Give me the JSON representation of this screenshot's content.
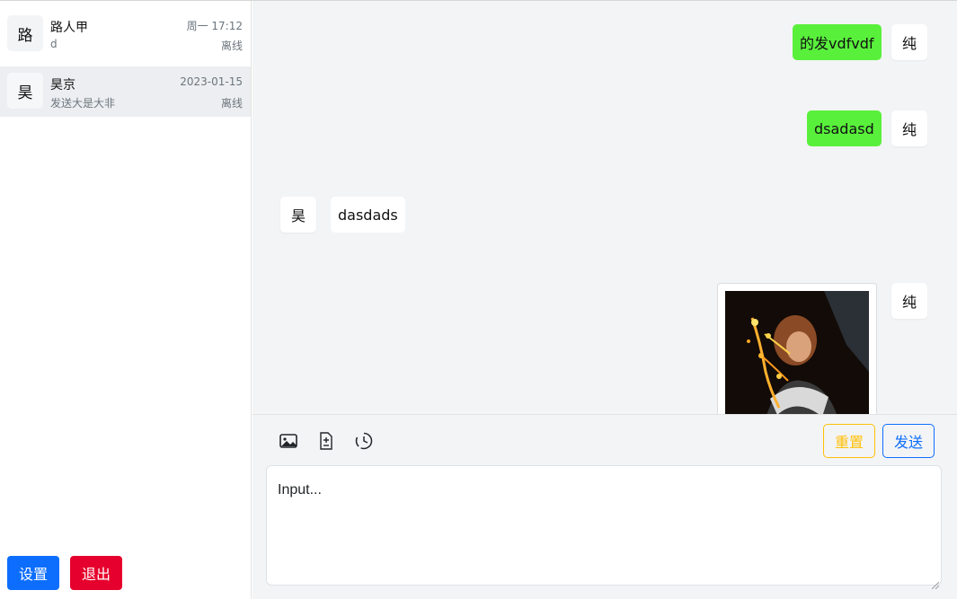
{
  "sidebar": {
    "contacts": [
      {
        "avatar": "路",
        "name": "路人甲",
        "last_message": "d",
        "time": "周一 17:12",
        "status": "离线",
        "active": false
      },
      {
        "avatar": "昊",
        "name": "昊京",
        "last_message": "发送大是大非",
        "time": "2023-01-15",
        "status": "离线",
        "active": true
      }
    ],
    "settings_label": "设置",
    "logout_label": "退出"
  },
  "chat": {
    "messages": [
      {
        "direction": "sent",
        "avatar": "纯",
        "text": "的发vdfvdf"
      },
      {
        "direction": "sent",
        "avatar": "纯",
        "text": "dsadasd"
      },
      {
        "direction": "received",
        "avatar": "昊",
        "text": "dasdads"
      },
      {
        "direction": "sent",
        "avatar": "纯",
        "type": "image"
      }
    ]
  },
  "composer": {
    "tools": [
      "image-icon",
      "file-diff-icon",
      "clock-history-icon"
    ],
    "reset_label": "重置",
    "send_label": "发送",
    "input_placeholder": "Input...",
    "input_value": ""
  },
  "colors": {
    "primary": "#0d6efd",
    "danger": "#e6002d",
    "warning": "#ffc107",
    "sent_bubble": "#59f03c",
    "chat_background": "#f3f4f6"
  }
}
